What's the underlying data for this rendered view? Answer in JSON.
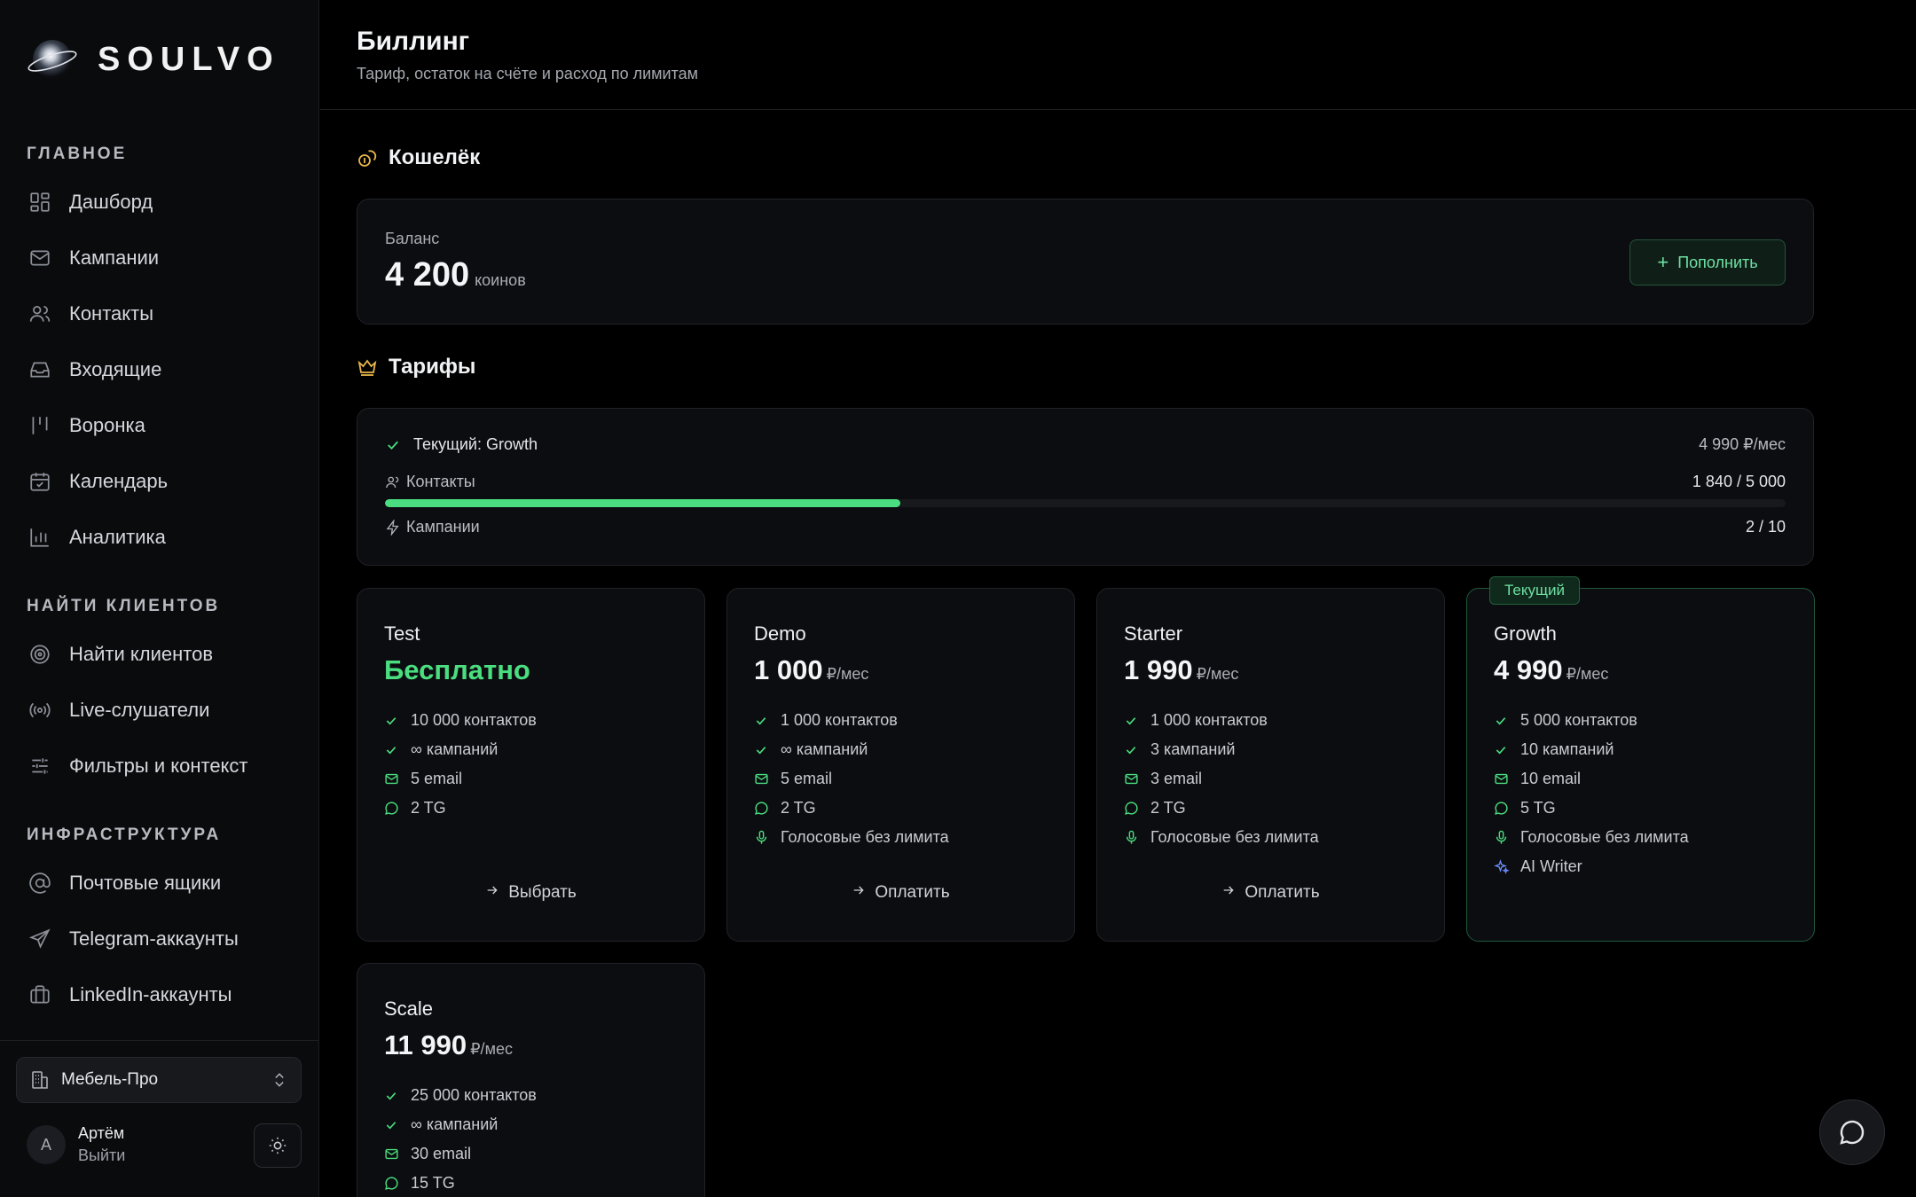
{
  "app": {
    "brand": "SOULVO"
  },
  "sidebar": {
    "sections": [
      {
        "title": "ГЛАВНОЕ"
      },
      {
        "title": "НАЙТИ КЛИЕНТОВ"
      },
      {
        "title": "ИНФРАСТРУКТУРА"
      }
    ],
    "items": [
      {
        "label": "Дашборд",
        "icon": "dashboard-icon"
      },
      {
        "label": "Кампании",
        "icon": "mail-icon"
      },
      {
        "label": "Контакты",
        "icon": "users-icon"
      },
      {
        "label": "Входящие",
        "icon": "inbox-icon"
      },
      {
        "label": "Воронка",
        "icon": "pipeline-icon"
      },
      {
        "label": "Календарь",
        "icon": "calendar-icon"
      },
      {
        "label": "Аналитика",
        "icon": "analytics-icon"
      },
      {
        "label": "Найти клиентов",
        "icon": "target-icon"
      },
      {
        "label": "Live-слушатели",
        "icon": "broadcast-icon"
      },
      {
        "label": "Фильтры и контекст",
        "icon": "sliders-icon"
      },
      {
        "label": "Почтовые ящики",
        "icon": "at-icon"
      },
      {
        "label": "Telegram-аккаунты",
        "icon": "send-icon"
      },
      {
        "label": "LinkedIn-аккаунты",
        "icon": "briefcase-icon"
      }
    ],
    "workspace": {
      "label": "Мебель-Про"
    },
    "user": {
      "initial": "А",
      "name": "Артём",
      "logout": "Выйти"
    }
  },
  "header": {
    "title": "Биллинг",
    "subtitle": "Тариф, остаток на счёте и расход по лимитам"
  },
  "wallet": {
    "title": "Кошелёк",
    "balance_label": "Баланс",
    "balance_value": "4 200",
    "balance_unit": "коинов",
    "topup_label": "Пополнить"
  },
  "tariffs": {
    "title": "Тарифы",
    "current": {
      "label": "Текущий: Growth",
      "price": "4 990 ₽/мес",
      "contacts_label": "Контакты",
      "contacts_value": "1 840 / 5 000",
      "contacts_fraction": 0.368,
      "campaigns_label": "Кампании",
      "campaigns_value": "2 / 10"
    },
    "current_badge": "Текущий",
    "plans": [
      {
        "name": "Test",
        "price": "Бесплатно",
        "per": "",
        "features": [
          "10 000 контактов",
          "∞ кампаний",
          "5 email",
          "2 TG"
        ],
        "action": "Выбрать"
      },
      {
        "name": "Demo",
        "price": "1 000",
        "per": "₽/мес",
        "features": [
          "1 000 контактов",
          "∞ кампаний",
          "5 email",
          "2 TG",
          "Голосовые без лимита"
        ],
        "action": "Оплатить"
      },
      {
        "name": "Starter",
        "price": "1 990",
        "per": "₽/мес",
        "features": [
          "1 000 контактов",
          "3 кампаний",
          "3 email",
          "2 TG",
          "Голосовые без лимита"
        ],
        "action": "Оплатить"
      },
      {
        "name": "Growth",
        "price": "4 990",
        "per": "₽/мес",
        "features": [
          "5 000 контактов",
          "10 кампаний",
          "10 email",
          "5 TG",
          "Голосовые без лимита",
          "AI Writer"
        ],
        "action": ""
      },
      {
        "name": "Scale",
        "price": "11 990",
        "per": "₽/мес",
        "features": [
          "25 000 контактов",
          "∞ кампаний",
          "30 email",
          "15 TG"
        ],
        "action": ""
      }
    ]
  },
  "colors": {
    "accent_green": "#4ade80",
    "accent_gold": "#e9b64a",
    "background": "#000000"
  }
}
